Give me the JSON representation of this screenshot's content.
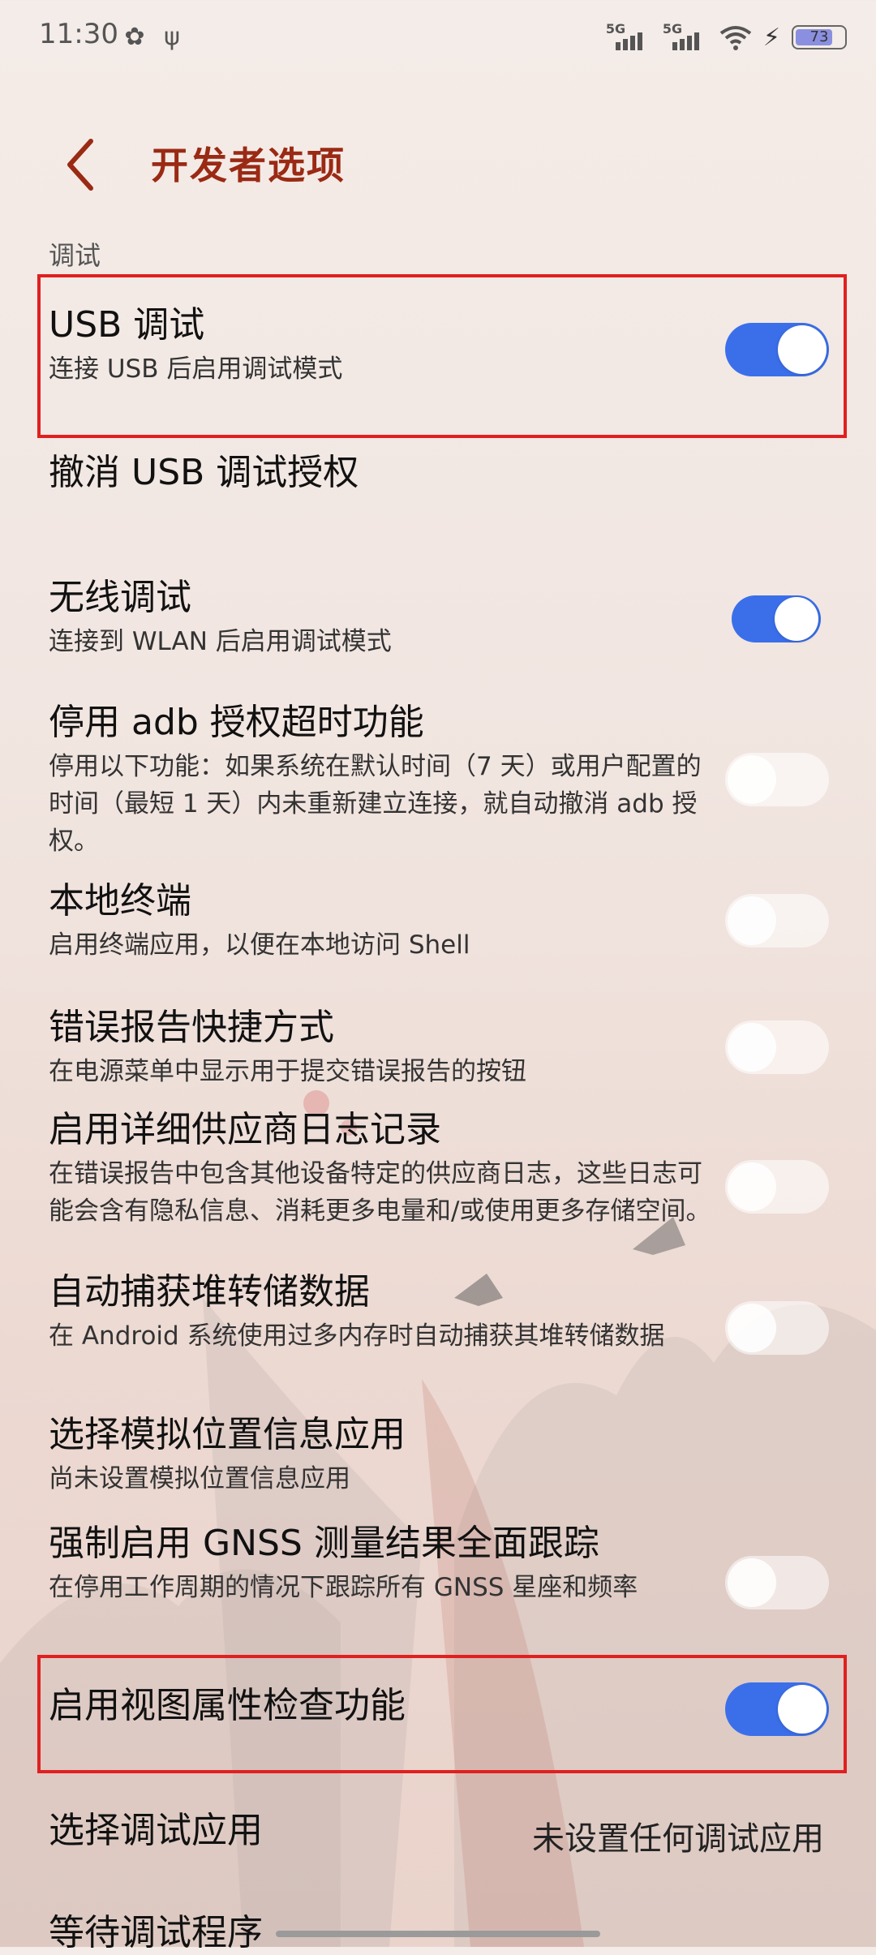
{
  "status_bar": {
    "time": "11:30",
    "signal1": "5G",
    "signal2": "5G",
    "battery": "73"
  },
  "header": {
    "title": "开发者选项"
  },
  "section_label": "调试",
  "items": [
    {
      "title": "USB 调试",
      "subtitle": "连接 USB 后启用调试模式",
      "toggle": "on"
    },
    {
      "title": "撤消 USB 调试授权",
      "subtitle": ""
    },
    {
      "title": "无线调试",
      "subtitle": "连接到 WLAN 后启用调试模式",
      "toggle": "on"
    },
    {
      "title": "停用 adb 授权超时功能",
      "subtitle": "停用以下功能：如果系统在默认时间（7 天）或用户配置的时间（最短 1 天）内未重新建立连接，就自动撤消 adb 授权。",
      "toggle": "off"
    },
    {
      "title": "本地终端",
      "subtitle": "启用终端应用，以便在本地访问 Shell",
      "toggle": "off"
    },
    {
      "title": "错误报告快捷方式",
      "subtitle": "在电源菜单中显示用于提交错误报告的按钮",
      "toggle": "off"
    },
    {
      "title": "启用详细供应商日志记录",
      "subtitle": "在错误报告中包含其他设备特定的供应商日志，这些日志可能会含有隐私信息、消耗更多电量和/或使用更多存储空间。",
      "toggle": "off"
    },
    {
      "title": "自动捕获堆转储数据",
      "subtitle": "在 Android 系统使用过多内存时自动捕获其堆转储数据",
      "toggle": "off"
    },
    {
      "title": "选择模拟位置信息应用",
      "subtitle": "尚未设置模拟位置信息应用"
    },
    {
      "title": "强制启用 GNSS 测量结果全面跟踪",
      "subtitle": "在停用工作周期的情况下跟踪所有 GNSS 星座和频率",
      "toggle": "off"
    },
    {
      "title": "启用视图属性检查功能",
      "subtitle": "",
      "toggle": "on"
    },
    {
      "title": "选择调试应用",
      "value": "未设置任何调试应用"
    },
    {
      "title": "等待调试程序"
    }
  ]
}
